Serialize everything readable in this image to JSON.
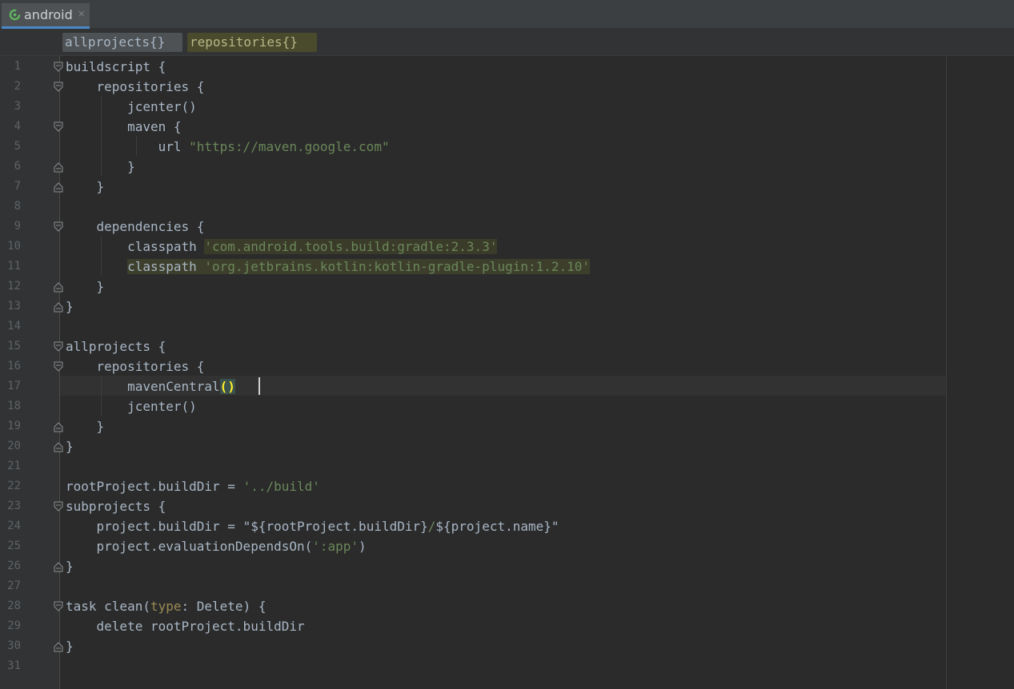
{
  "tab": {
    "label": "android",
    "close": "×",
    "icon": "gradle-sync-icon"
  },
  "breadcrumbs": [
    "allprojects{}",
    "repositories{}"
  ],
  "line_numbers": [
    "1",
    "2",
    "3",
    "4",
    "5",
    "6",
    "7",
    "8",
    "9",
    "10",
    "11",
    "12",
    "13",
    "14",
    "15",
    "16",
    "17",
    "18",
    "19",
    "20",
    "21",
    "22",
    "23",
    "24",
    "25",
    "26",
    "27",
    "28",
    "29",
    "30",
    "31"
  ],
  "code": {
    "l1": "buildscript {",
    "l2": "    repositories {",
    "l3": "        jcenter()",
    "l4": "        maven {",
    "l5a": "            url ",
    "l5b": "\"https://maven.google.com\"",
    "l6": "        }",
    "l7": "    }",
    "l9": "    dependencies {",
    "l10a": "        classpath",
    "l10b": " ",
    "l10c": "'com.android.tools.build:gradle:2.3.3'",
    "l11a": "        ",
    "l11b": "classpath ",
    "l11c": "'org.jetbrains.kotlin:kotlin-gradle-plugin:1.2.10'",
    "l12": "    }",
    "l13": "}",
    "l15": "allprojects {",
    "l16": "    repositories {",
    "l17a": "        mavenCentral",
    "l17b": "()",
    "l18": "        jcenter()",
    "l19": "    }",
    "l20": "}",
    "l22a": "rootProject.buildDir = ",
    "l22b": "'../build'",
    "l23": "subprojects {",
    "l24a": "    project.buildDir = ",
    "l24b": "\"${rootProject.buildDir}",
    "l24c": "/",
    "l24d": "${project.name}\"",
    "l25a": "    project.evaluationDependsOn(",
    "l25b": "':app'",
    "l25c": ")",
    "l26": "}",
    "l28a": "task clean(",
    "l28b": "type",
    "l28c": ": Delete) {",
    "l29": "    delete rootProject.buildDir",
    "l30": "}"
  },
  "colors": {
    "background": "#2b2b2b",
    "gutter": "#313335",
    "text": "#a9b7c6",
    "string": "#6a8759",
    "keyword": "#cc7832",
    "accent": "#4a88c7"
  }
}
